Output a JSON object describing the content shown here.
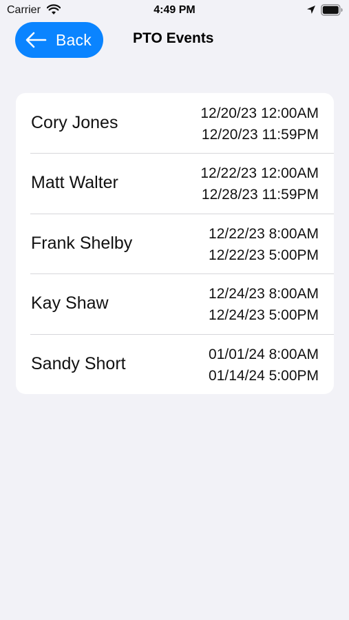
{
  "status_bar": {
    "carrier": "Carrier",
    "time": "4:49 PM"
  },
  "nav": {
    "back_label": "Back",
    "title": "PTO Events",
    "accent": "#0a84ff"
  },
  "events": [
    {
      "name": "Cory Jones",
      "start": "12/20/23 12:00AM",
      "end": "12/20/23 11:59PM"
    },
    {
      "name": "Matt Walter",
      "start": "12/22/23 12:00AM",
      "end": "12/28/23 11:59PM"
    },
    {
      "name": "Frank Shelby",
      "start": "12/22/23 8:00AM",
      "end": "12/22/23 5:00PM"
    },
    {
      "name": "Kay Shaw",
      "start": "12/24/23 8:00AM",
      "end": "12/24/23 5:00PM"
    },
    {
      "name": "Sandy Short",
      "start": "01/01/24 8:00AM",
      "end": "01/14/24 5:00PM"
    }
  ]
}
